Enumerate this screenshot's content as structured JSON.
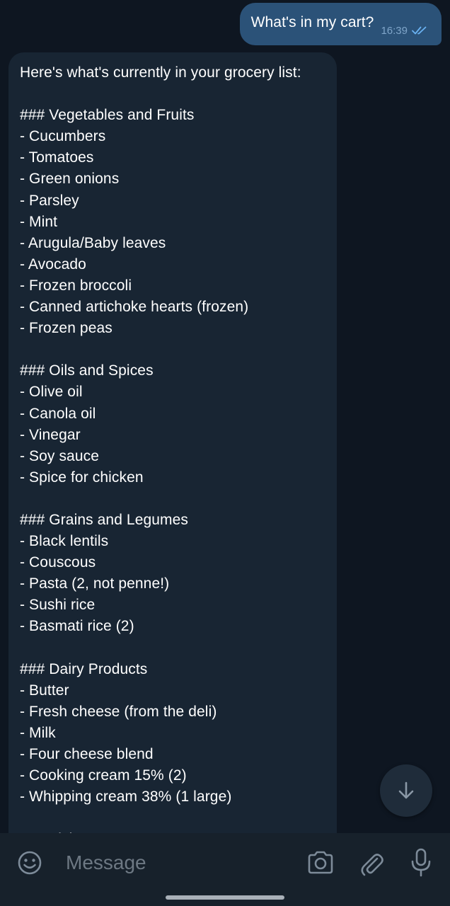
{
  "chat": {
    "outgoing": {
      "text": "What's in my cart?",
      "time": "16:39",
      "status_icon": "double-check-icon"
    },
    "incoming": {
      "lines": [
        "Here's what's currently in your grocery list:",
        "",
        "### Vegetables and Fruits",
        "- Cucumbers",
        "- Tomatoes",
        "- Green onions",
        "- Parsley",
        "- Mint",
        "- Arugula/Baby leaves",
        "- Avocado",
        "- Frozen broccoli",
        "- Canned artichoke hearts (frozen)",
        "- Frozen peas",
        "",
        "### Oils and Spices",
        "- Olive oil",
        "- Canola oil",
        "- Vinegar",
        "- Soy sauce",
        "- Spice for chicken",
        "",
        "### Grains and Legumes",
        "- Black lentils",
        "- Couscous",
        "- Pasta (2, not penne!)",
        "- Sushi rice",
        "- Basmati rice (2)",
        "",
        "### Dairy Products",
        "- Butter",
        "- Fresh cheese (from the deli)",
        "- Milk",
        "- Four cheese blend",
        "- Cooking cream 15% (2)",
        "- Whipping cream 38% (1 large)",
        "",
        "### Fish"
      ]
    }
  },
  "composer": {
    "placeholder": "Message",
    "icons": [
      "emoji-icon",
      "camera-icon",
      "paperclip-icon",
      "microphone-icon"
    ]
  },
  "scroll_button": {
    "icon": "arrow-down-icon"
  },
  "colors": {
    "background": "#0e1621",
    "outgoing_bubble": "#2b5278",
    "incoming_bubble": "#182533",
    "composer_bar": "#17212b",
    "accent": "#6ab2f2",
    "muted_icon": "#7d8b99"
  }
}
